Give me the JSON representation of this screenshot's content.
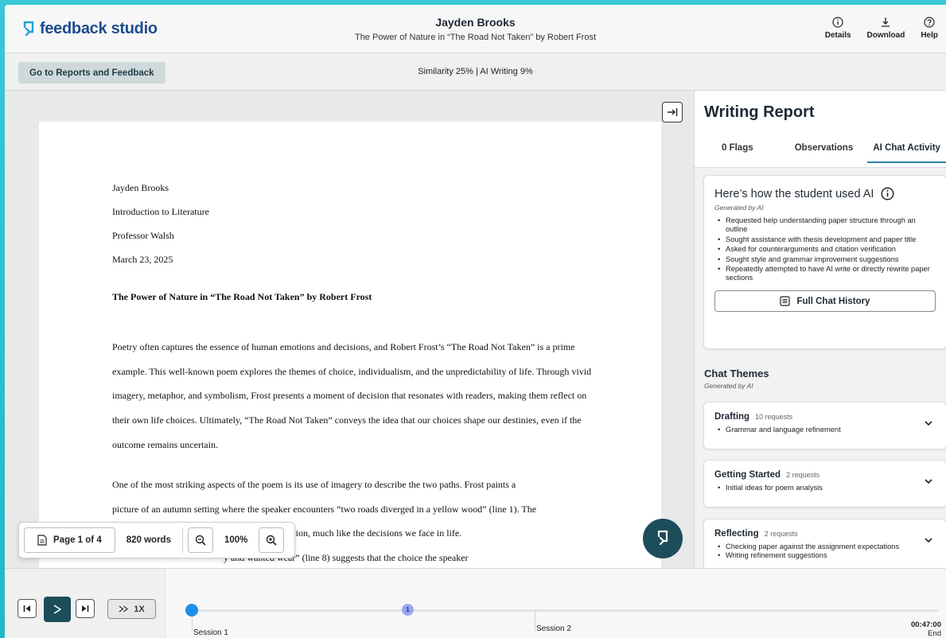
{
  "header": {
    "logo_text": "feedback studio",
    "student_name": "Jayden Brooks",
    "paper_title": "The Power of Nature in “The Road Not Taken” by Robert Frost",
    "actions": [
      {
        "label": "Details",
        "icon": "info-icon"
      },
      {
        "label": "Download",
        "icon": "download-icon"
      },
      {
        "label": "Help",
        "icon": "help-icon"
      }
    ]
  },
  "subbar": {
    "goto_label": "Go to Reports and Feedback",
    "scores": "Similarity 25%  |  AI Writing 9%"
  },
  "document": {
    "meta": [
      "Jayden Brooks",
      "Introduction to Literature",
      "Professor Walsh",
      "March 23, 2025"
    ],
    "title": "The Power of Nature in “The Road Not Taken” by Robert Frost",
    "para1": "Poetry often captures the essence of human emotions and decisions, and Robert Frost’s “The Road Not Taken” is a prime example. This well-known poem explores the themes of choice, individualism, and the unpredictability of life. Through vivid imagery, metaphor, and symbolism, Frost presents a moment of decision that resonates with readers, making them reflect on their own life choices. Ultimately, “The Road Not Taken” conveys the idea that our choices shape our destinies, even if the outcome remains uncertain.",
    "para2_l1": "One of the most striking aspects of the poem is its use of imagery to describe the two paths. Frost paints a",
    "para2_l2": "picture of an autumn setting where the speaker encounters “two roads diverged in a yellow wood” (line 1). The",
    "para2_l3": "ostalgia and transition, much like the decisions we face in life.",
    "para2_l4": "y and wanted wear” (line 8) suggests that the choice the speaker"
  },
  "pager": {
    "page_label": "Page 1 of 4",
    "words": "820 words",
    "zoom": "100%"
  },
  "panel": {
    "title": "Writing Report",
    "tabs": [
      "0 Flags",
      "Observations",
      "AI Chat Activity"
    ],
    "ai_card": {
      "heading": "Here’s how the student used AI",
      "generated": "Generated by AI",
      "bullets": [
        "Requested help understanding paper structure through an outline",
        "Sought assistance with thesis development and paper title",
        "Asked for counterarguments and citation verification",
        "Sought style and grammar improvement suggestions",
        "Repeatedly attempted to have AI write or directly rewrite paper sections"
      ],
      "button": "Full Chat History"
    },
    "themes_title": "Chat Themes",
    "themes_generated": "Generated by AI",
    "themes": [
      {
        "name": "Drafting",
        "count": "10 requests",
        "items": [
          "Grammar and language refinement"
        ]
      },
      {
        "name": "Getting Started",
        "count": "2 requests",
        "items": [
          "Initial ideas for poem analysis"
        ]
      },
      {
        "name": "Reflecting",
        "count": "2 requests",
        "items": [
          "Checking paper against the assignment expectations",
          "Writing refinement suggestions"
        ]
      }
    ]
  },
  "playback": {
    "speed": "1X",
    "marker": "1",
    "session1": "Session 1",
    "session2": "Session 2",
    "end_time": "00:47:00",
    "end_label": "End",
    "progress": 0
  },
  "colors": {
    "accent": "#1c4d5a",
    "brand": "#1e4b8f",
    "tab_underline": "#2a7fa3",
    "timeline_knob": "#1e8fe8"
  }
}
